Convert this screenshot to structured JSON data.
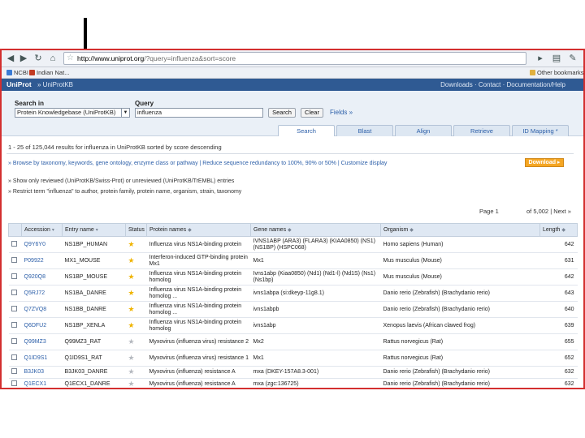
{
  "browser": {
    "url_host": "http://www.uniprot.org",
    "url_path": "/?query=influenza&sort=score",
    "bookmarks": [
      {
        "label": "NCBI",
        "color": "#3a7bd5"
      },
      {
        "label": "Indian Nat...",
        "color": "#c23b22"
      }
    ],
    "other_bookmarks": "Other bookmarks"
  },
  "header": {
    "logo": "UniProt",
    "section": "» UniProtKB",
    "links": "Downloads · Contact · Documentation/Help"
  },
  "search": {
    "search_in_label": "Search in",
    "query_label": "Query",
    "database": "Protein Knowledgebase (UniProtKB)",
    "query": "influenza",
    "search_button": "Search",
    "clear_button": "Clear",
    "fields_link": "Fields »",
    "tabs": [
      {
        "label": "Search",
        "active": true
      },
      {
        "label": "Blast",
        "active": false
      },
      {
        "label": "Align",
        "active": false
      },
      {
        "label": "Retrieve",
        "active": false
      },
      {
        "label": "ID Mapping *",
        "active": false
      }
    ]
  },
  "results": {
    "summary": "1 - 25 of 125,044 results for influenza in UniProtKB sorted by score descending",
    "tools": "» Browse by taxonomy, keywords, gene ontology, enzyme class or pathway | Reduce sequence redundancy to 100%, 90% or 50% | Customize display",
    "download": "Download ▸",
    "filter_reviewed": "» Show only reviewed (UniProtKB/Swiss-Prot) or unreviewed (UniProtKB/TrEMBL) entries",
    "filter_restrict": "» Restrict term \"influenza\" to author, protein family, protein name, organism, strain, taxonomy",
    "pager_page": "Page 1",
    "pager_of": "of 5,002 | Next »",
    "columns": [
      "",
      "Accession",
      "Entry name",
      "Status",
      "Protein names",
      "Gene names",
      "Organism",
      "Length"
    ],
    "rows": [
      {
        "accession": "Q9Y6Y0",
        "entry": "NS1BP_HUMAN",
        "reviewed": true,
        "protein": "Influenza virus NS1A-binding protein",
        "gene": "IVNS1ABP (ARA3) (FLARA3) (KIAA0850) (NS1) (NS1BP) (HSPC068)",
        "organism": "Homo sapiens (Human)",
        "length": "642"
      },
      {
        "accession": "P09922",
        "entry": "MX1_MOUSE",
        "reviewed": true,
        "protein": "Interferon-induced GTP-binding protein Mx1",
        "gene": "Mx1",
        "organism": "Mus musculus (Mouse)",
        "length": "631"
      },
      {
        "accession": "Q920Q8",
        "entry": "NS1BP_MOUSE",
        "reviewed": true,
        "protein": "Influenza virus NS1A-binding protein homolog",
        "gene": "Ivns1abp (Kiaa0850) (Nd1) (Nd1-l) (Nd1S) (Ns1) (Ns1bp)",
        "organism": "Mus musculus (Mouse)",
        "length": "642"
      },
      {
        "accession": "Q5RJ72",
        "entry": "NS1BA_DANRE",
        "reviewed": true,
        "protein": "Influenza virus NS1A-binding protein homolog ...",
        "gene": "ivns1abpa (si:dkeyp-11g8.1)",
        "organism": "Danio rerio (Zebrafish) (Brachydanio rerio)",
        "length": "643"
      },
      {
        "accession": "Q7ZVQ8",
        "entry": "NS1BB_DANRE",
        "reviewed": true,
        "protein": "Influenza virus NS1A-binding protein homolog ...",
        "gene": "ivns1abpb",
        "organism": "Danio rerio (Zebrafish) (Brachydanio rerio)",
        "length": "640"
      },
      {
        "accession": "Q6DFU2",
        "entry": "NS1BP_XENLA",
        "reviewed": true,
        "protein": "Influenza virus NS1A-binding protein homolog",
        "gene": "ivns1abp",
        "organism": "Xenopus laevis (African clawed frog)",
        "length": "639"
      },
      {
        "accession": "Q99MZ3",
        "entry": "Q99MZ3_RAT",
        "reviewed": false,
        "protein": "Myxovirus (influenza virus) resistance 2",
        "gene": "Mx2",
        "organism": "Rattus norvegicus (Rat)",
        "length": "655"
      },
      {
        "accession": "Q1ID9S1",
        "entry": "Q1ID9S1_RAT",
        "reviewed": false,
        "protein": "Myxovirus (influenza virus) resistance 1",
        "gene": "Mx1",
        "organism": "Rattus norvegicus (Rat)",
        "length": "652"
      },
      {
        "accession": "B3JK03",
        "entry": "B3JK03_DANRE",
        "reviewed": false,
        "protein": "Myxovirus (influenza) resistance A",
        "gene": "mxa (DKEY-157A8.3-001)",
        "organism": "Danio rerio (Zebrafish) (Brachydanio rerio)",
        "length": "632"
      },
      {
        "accession": "Q1ECX1",
        "entry": "Q1ECX1_DANRE",
        "reviewed": false,
        "protein": "Myxovirus (influenza) resistance A",
        "gene": "mxa (zgc:136725)",
        "organism": "Danio rerio (Zebrafish) (Brachydanio rerio)",
        "length": "632"
      }
    ]
  }
}
